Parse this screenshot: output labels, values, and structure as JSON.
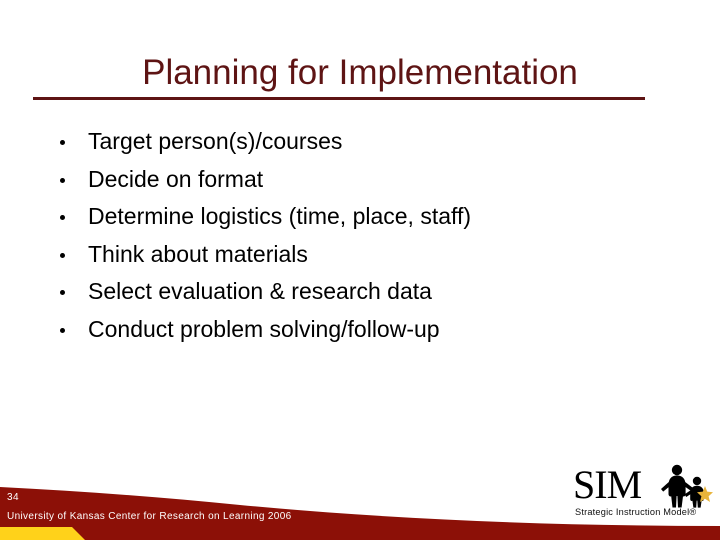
{
  "slide": {
    "title": "Planning for Implementation",
    "bullets": [
      "Target person(s)/courses",
      "Decide on format",
      "Determine logistics (time, place, staff)",
      "Think about materials",
      "Select evaluation & research data",
      "Conduct problem solving/follow-up"
    ]
  },
  "footer": {
    "slide_number": "34",
    "credit": "University of Kansas Center for Research on Learning  2006",
    "band_color": "#8C1007",
    "accent_color": "#FFD21A"
  },
  "logo": {
    "wordmark": "SIM",
    "tagline": "Strategic Instruction Model®",
    "star_color": "#E8B43A",
    "figure_color": "#000000"
  },
  "theme": {
    "title_color": "#5E1414",
    "body_color": "#000000",
    "background": "#FFFFFF"
  }
}
